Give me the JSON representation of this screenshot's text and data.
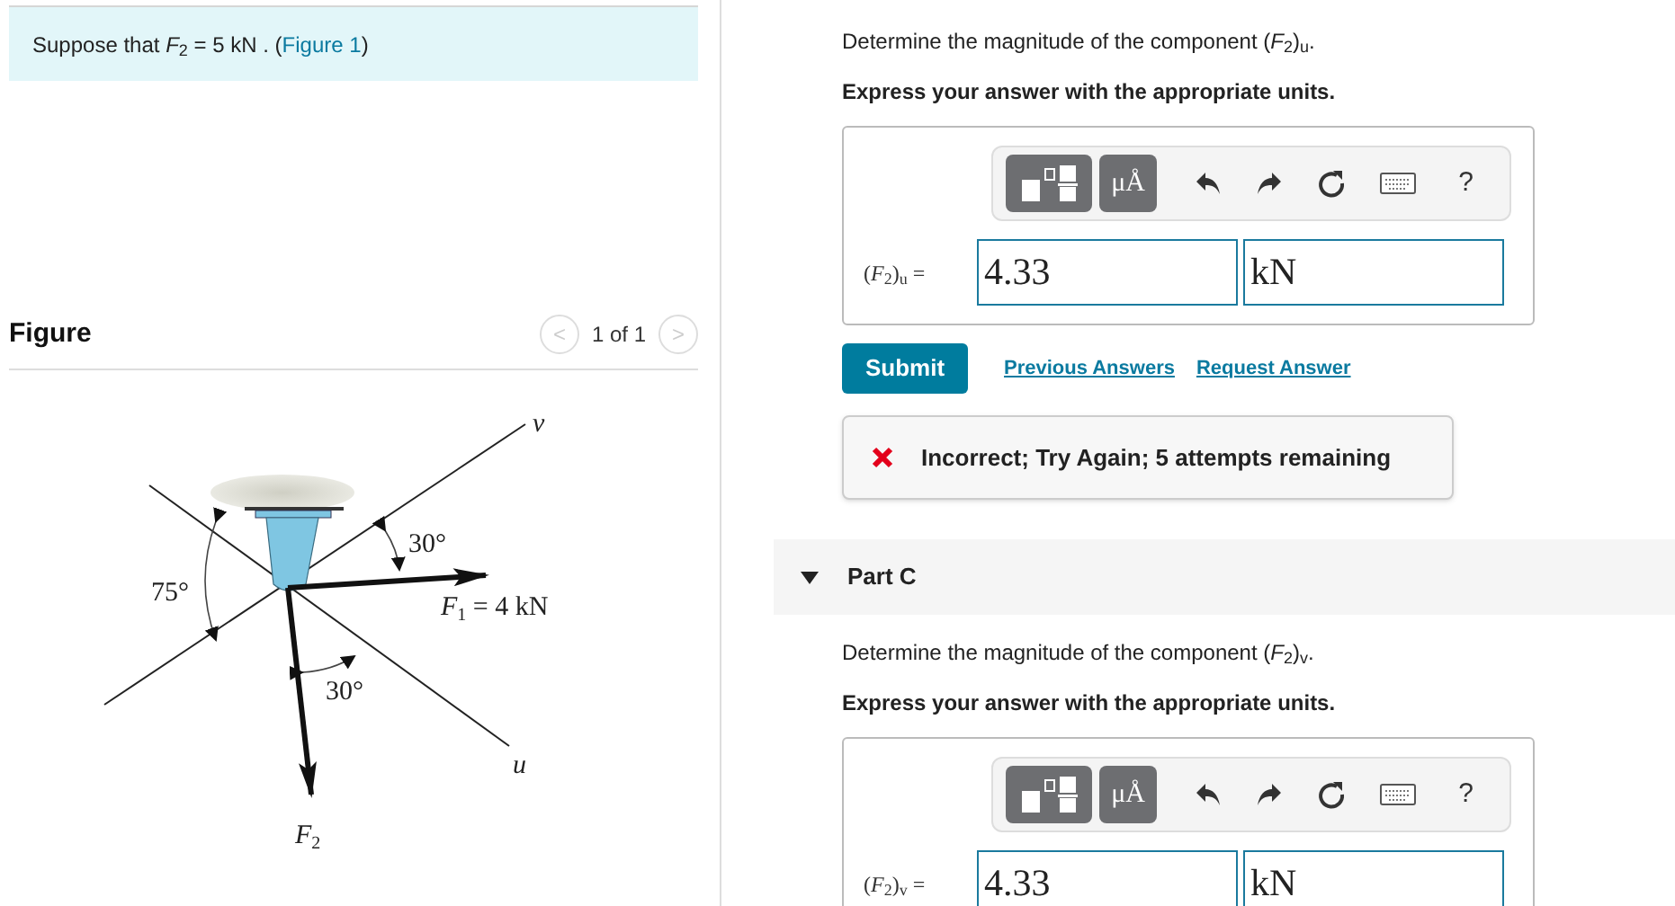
{
  "intro": {
    "before": "Suppose that *F*$_{2}$ = 5  kN . (",
    "link": "Figure 1",
    "after": ")"
  },
  "figure": {
    "title": "Figure",
    "pager": "1 of 1",
    "prev": "<",
    "next": ">",
    "labels": {
      "v": "v",
      "u": "u",
      "angle_left": "75°",
      "angle_top": "30°",
      "angle_bottom": "30°",
      "f1": {
        "main": "F",
        "sub": "1",
        "rest": " = 4 kN"
      },
      "f2": {
        "main": "F",
        "sub": "2"
      }
    }
  },
  "parts": [
    {
      "question": "Determine the magnitude of the component (*F*$_{2}$)$_{u}$.",
      "instruction": "Express your answer with the appropriate units.",
      "toolbar": [
        {
          "kind": "template"
        },
        {
          "kind": "units",
          "label": "μÅ"
        },
        {
          "kind": "undo"
        },
        {
          "kind": "redo"
        },
        {
          "kind": "reset"
        },
        {
          "kind": "keyboard"
        },
        {
          "kind": "help",
          "label": "?"
        }
      ],
      "answer_label": "(*F*$_{2}$)$_{u}$ =",
      "value": "4.33",
      "unit": "kN",
      "submit": "Submit",
      "links": [
        "Previous Answers",
        "Request Answer"
      ],
      "feedback": {
        "kind": "incorrect",
        "text": "Incorrect; Try Again; 5 attempts remaining"
      }
    },
    {
      "header": "Part C",
      "expanded": true,
      "question": "Determine the magnitude of the component (*F*$_{2}$)$_{v}$.",
      "instruction": "Express your answer with the appropriate units.",
      "toolbar": [
        {
          "kind": "template"
        },
        {
          "kind": "units",
          "label": "μÅ"
        },
        {
          "kind": "undo"
        },
        {
          "kind": "redo"
        },
        {
          "kind": "reset"
        },
        {
          "kind": "keyboard"
        },
        {
          "kind": "help",
          "label": "?"
        }
      ],
      "answer_label": "(*F*$_{2}$)$_{v}$ =",
      "value": "4.33",
      "unit": "kN"
    }
  ]
}
